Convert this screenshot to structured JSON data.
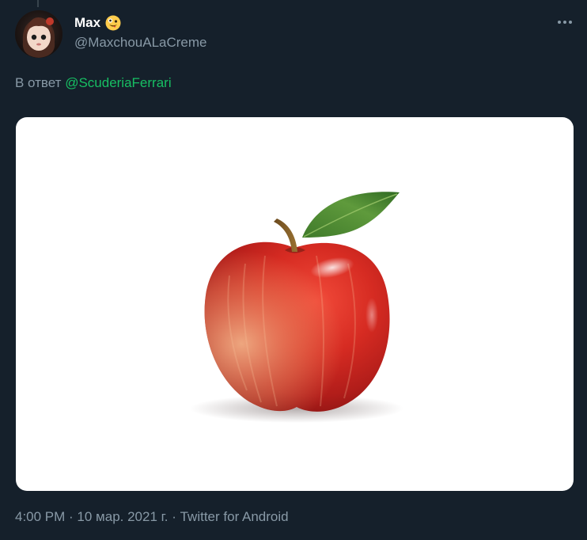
{
  "user": {
    "display_name": "Max",
    "handle": "@MaxchouALaCreme",
    "badge_icon": "zany-face-emoji-icon"
  },
  "reply": {
    "prefix": "В ответ",
    "mention": "@ScuderiaFerrari"
  },
  "media": {
    "subject": "red-apple-image"
  },
  "meta": {
    "time": "4:00 PM",
    "separator1": " · ",
    "date": "10 мар. 2021 г.",
    "separator2": " · ",
    "source": "Twitter for Android"
  },
  "colors": {
    "background": "#15202b",
    "secondary_text": "#8899a6",
    "mention": "#17bf63"
  }
}
